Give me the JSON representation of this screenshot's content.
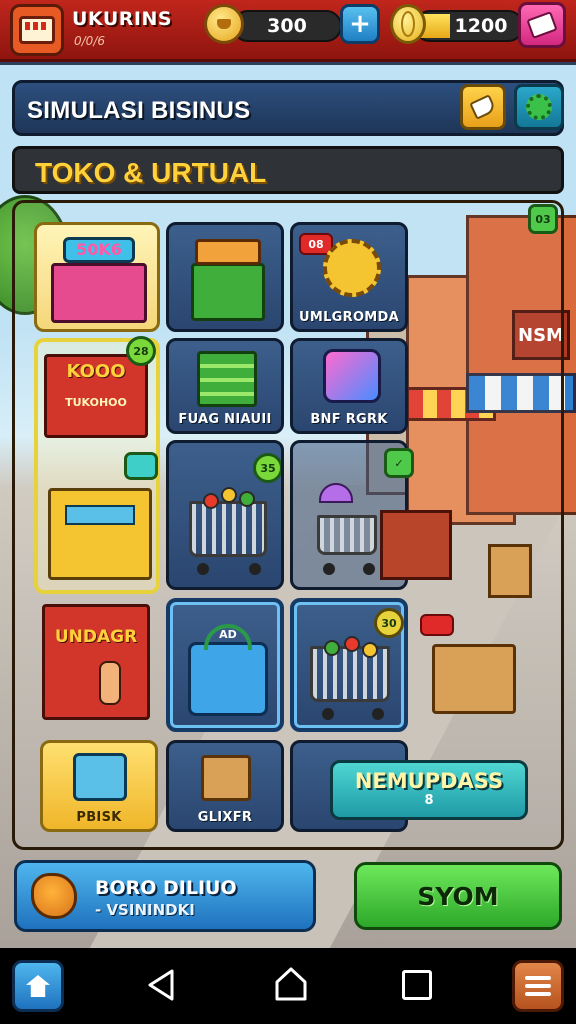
{
  "top_bar": {
    "player_name": "UKURINS",
    "player_sub": "0/0/6",
    "crowns": "300",
    "coins": "1200"
  },
  "header": {
    "title": "SIMULASI BISINUS",
    "subtitle": "TOKO & URTUAL"
  },
  "tiles": {
    "shop_sign": "50K6",
    "r1c3_badge": "08",
    "r1c3_label": "UMLGROMDA",
    "shop2_sign": "KOOO",
    "shop2_sub": "TUKOHOO",
    "shop2_badge": "28",
    "r2c2_label": "FUAG NIAUII",
    "r2c3_label": "BNF RGRK",
    "r3c2_badge": "35",
    "r4c1_sign": "UNDAGR",
    "r4c2_sign": "AD",
    "r4c3_badge": "30",
    "r5c1_label": "PBISK",
    "r5c2_label": "GLIXFR",
    "street_badge": "03"
  },
  "buttons": {
    "next_line1": "NEMUPDASS",
    "next_line2": "8",
    "info_line1": "BORO DILIUO",
    "info_line2": "- VSININDKI",
    "start": "SYOM"
  },
  "colors": {
    "top_bar": "#c0261c",
    "primary_blue": "#1f72be",
    "start_green": "#2da82a",
    "accent_yellow": "#ffd23c"
  }
}
